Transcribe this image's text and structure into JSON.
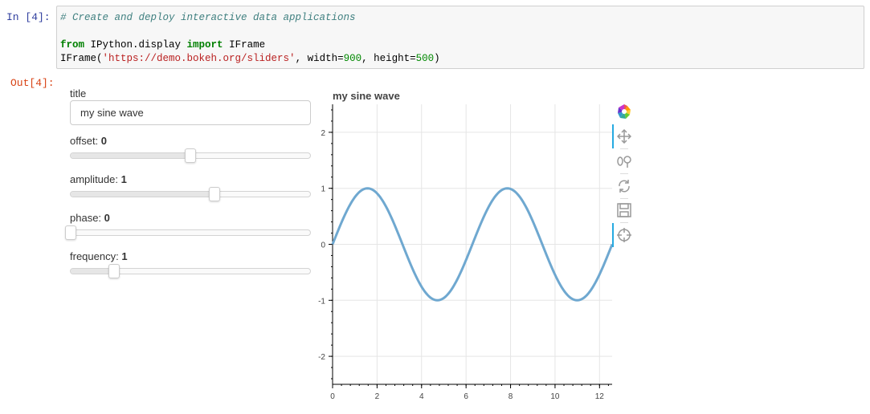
{
  "notebook": {
    "in_prompt": "In  [4]:",
    "out_prompt": "Out[4]:",
    "code": {
      "comment": "# Create and deploy interactive data applications",
      "line2_kw1": "from",
      "line2_mod": " IPython.display ",
      "line2_kw2": "import",
      "line2_name": " IFrame",
      "line3_fn": "IFrame(",
      "line3_url": "'https://demo.bokeh.org/sliders'",
      "line3_a": ", width=",
      "line3_w": "900",
      "line3_b": ", height=",
      "line3_h": "500",
      "line3_c": ")"
    }
  },
  "widgets": {
    "title_label": "title",
    "title_value": "my sine wave",
    "sliders": [
      {
        "label": "offset: ",
        "value": "0",
        "fraction": 0.5
      },
      {
        "label": "amplitude: ",
        "value": "1",
        "fraction": 0.6
      },
      {
        "label": "phase: ",
        "value": "0",
        "fraction": 0.0
      },
      {
        "label": "frequency: ",
        "value": "1",
        "fraction": 0.18
      }
    ]
  },
  "toolbar": {
    "tools": [
      "bokeh-logo-icon",
      "pan-icon",
      "wheel-zoom-icon",
      "reset-icon",
      "save-icon",
      "crosshair-icon"
    ]
  },
  "chart_data": {
    "type": "line",
    "title": "my sine wave",
    "xlabel": "",
    "ylabel": "",
    "xlim": [
      0,
      12.566
    ],
    "ylim": [
      -2.5,
      2.5
    ],
    "xticks": [
      "0",
      "2",
      "4",
      "6",
      "8",
      "10",
      "12"
    ],
    "yticks": [
      "2",
      "1",
      "0",
      "-1",
      "-2"
    ],
    "grid": true,
    "series": [
      {
        "function": "y = 1*sin(1*x + 0) + 0",
        "color": "#6fa8d0",
        "x_start": 0,
        "x_end": 12.566,
        "peak": 1,
        "trough": -1
      }
    ]
  }
}
